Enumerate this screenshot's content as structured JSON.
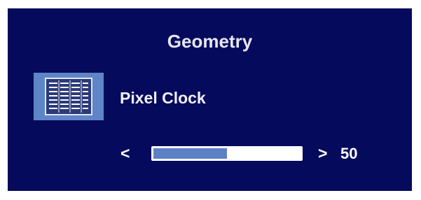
{
  "osd": {
    "title": "Geometry",
    "item": {
      "icon": "pixel-clock-icon",
      "label": "Pixel Clock"
    },
    "slider": {
      "decrease_glyph": "<",
      "increase_glyph": ">",
      "value": "50",
      "level_percent": 50
    }
  },
  "colors": {
    "background": "#060a5c",
    "accent": "#5e85c6",
    "bar_track": "#ffffff"
  }
}
